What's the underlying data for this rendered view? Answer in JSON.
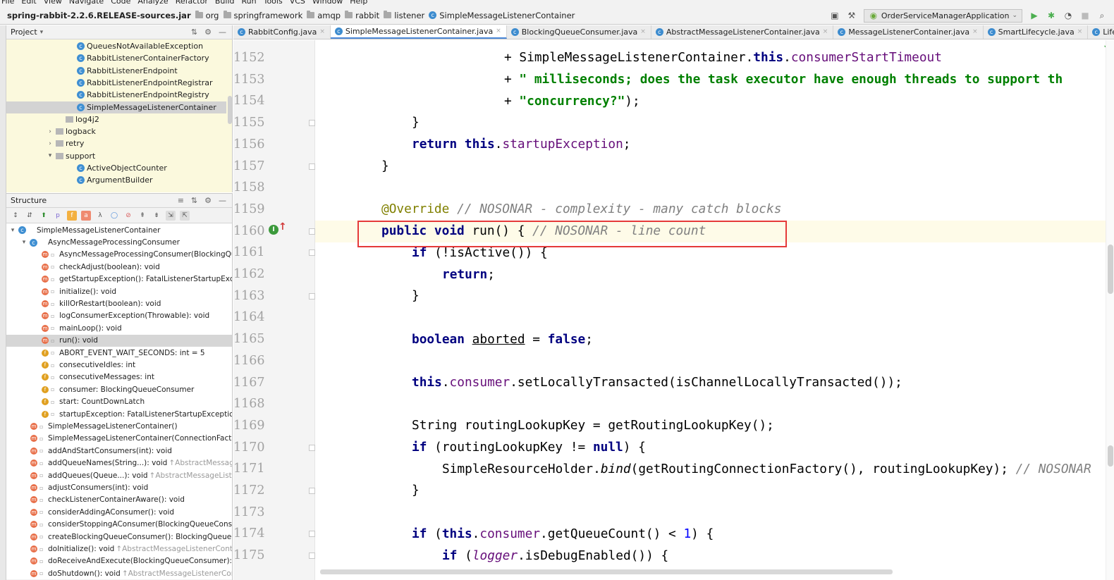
{
  "menu": [
    "File",
    "Edit",
    "View",
    "Navigate",
    "Code",
    "Analyze",
    "Refactor",
    "Build",
    "Run",
    "Tools",
    "VCS",
    "Window",
    "Help"
  ],
  "breadcrumbs": {
    "jar": "spring-rabbit-2.2.6.RELEASE-sources.jar",
    "items": [
      "org",
      "springframework",
      "amqp",
      "rabbit",
      "listener"
    ],
    "current": "SimpleMessageListenerContainer"
  },
  "run_config": "OrderServiceManagerApplication",
  "project_panel": {
    "title": "Project",
    "rows": [
      {
        "label": "QueuesNotAvailableException",
        "kind": "class",
        "indent": 100
      },
      {
        "label": "RabbitListenerContainerFactory",
        "kind": "class",
        "indent": 100
      },
      {
        "label": "RabbitListenerEndpoint",
        "kind": "class",
        "indent": 100
      },
      {
        "label": "RabbitListenerEndpointRegistrar",
        "kind": "class",
        "indent": 100
      },
      {
        "label": "RabbitListenerEndpointRegistry",
        "kind": "class",
        "indent": 100
      },
      {
        "label": "SimpleMessageListenerContainer",
        "kind": "class",
        "indent": 100,
        "selected": true
      },
      {
        "label": "log4j2",
        "kind": "pkg",
        "indent": 84
      },
      {
        "label": "logback",
        "kind": "pkg",
        "indent": 70,
        "arrow": "right"
      },
      {
        "label": "retry",
        "kind": "pkg",
        "indent": 70,
        "arrow": "right"
      },
      {
        "label": "support",
        "kind": "pkg",
        "indent": 70,
        "arrow": "down"
      },
      {
        "label": "ActiveObjectCounter",
        "kind": "class",
        "indent": 100
      },
      {
        "label": "ArgumentBuilder",
        "kind": "class",
        "indent": 100
      }
    ]
  },
  "structure_panel": {
    "title": "Structure",
    "rows": [
      {
        "label": "SimpleMessageListenerContainer",
        "kind": "class",
        "indent": 4,
        "arrow": "down"
      },
      {
        "label": "AsyncMessageProcessingConsumer",
        "kind": "class",
        "indent": 20,
        "arrow": "down"
      },
      {
        "label": "AsyncMessageProcessingConsumer(BlockingQueueConsumer)",
        "kind": "m",
        "indent": 50
      },
      {
        "label": "checkAdjust(boolean): void",
        "kind": "m",
        "indent": 50
      },
      {
        "label": "getStartupException(): FatalListenerStartupException",
        "kind": "m",
        "indent": 50
      },
      {
        "label": "initialize(): void",
        "kind": "m",
        "indent": 50
      },
      {
        "label": "killOrRestart(boolean): void",
        "kind": "m",
        "indent": 50
      },
      {
        "label": "logConsumerException(Throwable): void",
        "kind": "m",
        "indent": 50
      },
      {
        "label": "mainLoop(): void",
        "kind": "m",
        "indent": 50
      },
      {
        "label": "run(): void",
        "kind": "m",
        "indent": 50,
        "selected": true
      },
      {
        "label": "ABORT_EVENT_WAIT_SECONDS: int = 5",
        "kind": "f",
        "indent": 50
      },
      {
        "label": "consecutiveIdles: int",
        "kind": "f",
        "indent": 50
      },
      {
        "label": "consecutiveMessages: int",
        "kind": "f",
        "indent": 50
      },
      {
        "label": "consumer: BlockingQueueConsumer",
        "kind": "f",
        "indent": 50
      },
      {
        "label": "start: CountDownLatch",
        "kind": "f",
        "indent": 50
      },
      {
        "label": "startupException: FatalListenerStartupException",
        "kind": "f",
        "indent": 50
      },
      {
        "label": "SimpleMessageListenerContainer()",
        "kind": "m",
        "indent": 34
      },
      {
        "label": "SimpleMessageListenerContainer(ConnectionFactory)",
        "kind": "m",
        "indent": 34
      },
      {
        "label": "addAndStartConsumers(int): void",
        "kind": "m",
        "indent": 34
      },
      {
        "label": "addQueueNames(String...): void",
        "kind": "m",
        "indent": 34,
        "inherited": "↑AbstractMessageListenerContainer"
      },
      {
        "label": "addQueues(Queue...): void",
        "kind": "m",
        "indent": 34,
        "inherited": "↑AbstractMessageListenerContainer"
      },
      {
        "label": "adjustConsumers(int): void",
        "kind": "m",
        "indent": 34
      },
      {
        "label": "checkListenerContainerAware(): void",
        "kind": "m",
        "indent": 34
      },
      {
        "label": "considerAddingAConsumer(): void",
        "kind": "m",
        "indent": 34
      },
      {
        "label": "considerStoppingAConsumer(BlockingQueueConsumer)",
        "kind": "m",
        "indent": 34
      },
      {
        "label": "createBlockingQueueConsumer(): BlockingQueueConsumer",
        "kind": "m",
        "indent": 34
      },
      {
        "label": "doInitialize(): void",
        "kind": "m",
        "indent": 34,
        "inherited": "↑AbstractMessageListenerContainer"
      },
      {
        "label": "doReceiveAndExecute(BlockingQueueConsumer): boolean",
        "kind": "m",
        "indent": 34
      },
      {
        "label": "doShutdown(): void",
        "kind": "m",
        "indent": 34,
        "inherited": "↑AbstractMessageListenerContainer"
      }
    ]
  },
  "tabs": [
    {
      "label": "RabbitConfig.java",
      "active": false
    },
    {
      "label": "SimpleMessageListenerContainer.java",
      "active": true
    },
    {
      "label": "BlockingQueueConsumer.java",
      "active": false
    },
    {
      "label": "AbstractMessageListenerContainer.java",
      "active": false
    },
    {
      "label": "MessageListenerContainer.java",
      "active": false
    },
    {
      "label": "SmartLifecycle.java",
      "active": false
    },
    {
      "label": "Lifecycle.java",
      "active": false
    }
  ],
  "editor": {
    "line_numbers": [
      "1152",
      "1153",
      "1154",
      "1155",
      "1156",
      "1157",
      "1158",
      "1159",
      "1160",
      "1161",
      "1162",
      "1163",
      "1164",
      "1165",
      "1166",
      "1167",
      "1168",
      "1169",
      "1170",
      "1171",
      "1172",
      "1173",
      "1174",
      "1175"
    ],
    "highlight_line": "1160",
    "colors": {
      "keyword": "#000080",
      "string": "#008000",
      "field": "#660e7a",
      "comment": "#808080",
      "annotation": "#808000",
      "highlight_box": "#e53a3a"
    }
  }
}
